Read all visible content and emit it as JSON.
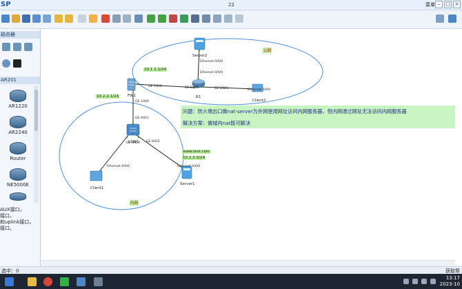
{
  "window": {
    "app_logo": "SP",
    "title": "22",
    "menu_label": "菜单▾"
  },
  "panel": {
    "header_router": "路由器",
    "header_model": "AR201",
    "devices": [
      "AR1220",
      "AR2240",
      "Router",
      "NE5000E"
    ],
    "description": [
      "AUX接口，",
      "接口，",
      "和uplink接口，",
      "接口。"
    ]
  },
  "topology": {
    "zone_public": "公网",
    "zone_private": "内网",
    "fw_name": "FW1",
    "router_name": "R1",
    "lsw_name": "LSW1",
    "server2_name": "Server2",
    "client2_name": "Client2",
    "client1_name": "Client1",
    "server1_name": "Server1",
    "ip_fw_out": "10.1.1.1/24",
    "ip_fw_in": "10.2.2.1/24",
    "server_domain": "www.test.com",
    "server_ip": "10.2.2.5/24",
    "ports": {
      "s2_eth": "Ethernet 0/0/0",
      "r1_eth": "Ethernet 0/0/0",
      "fw_g00": "GE 1/0/0",
      "r1_g00": "GE 0/0/0",
      "r1_g01": "GE 0/0/1",
      "c2_eth": "Ethernet 0/0/0",
      "fw_g01": "GE 1/0/0",
      "lsw_g01": "GE 0/0/1",
      "lsw_g03": "GE 0/0/3",
      "lsw_g02": "GE 0/0/2",
      "c1_eth": "Ethernet 0/0/0",
      "s1_eth": "Ethernet 0/0/0"
    }
  },
  "note": {
    "problem": "问题：防火墙出口做nat-server为外网使用网址访问内网服务器，但内网通过网址无法访问内网服务器",
    "solution": "解决方案：做域内nat既可解决"
  },
  "status": {
    "left": "选中：0",
    "right": "获取帮"
  },
  "clock": {
    "time": "13:17",
    "date": "2023-10"
  },
  "colors": {
    "zone_ring": "#4a90d9",
    "note_bg": "#c8f5c2",
    "tag_bg": "#b9ef9d",
    "accent": "#1f5fa8"
  }
}
